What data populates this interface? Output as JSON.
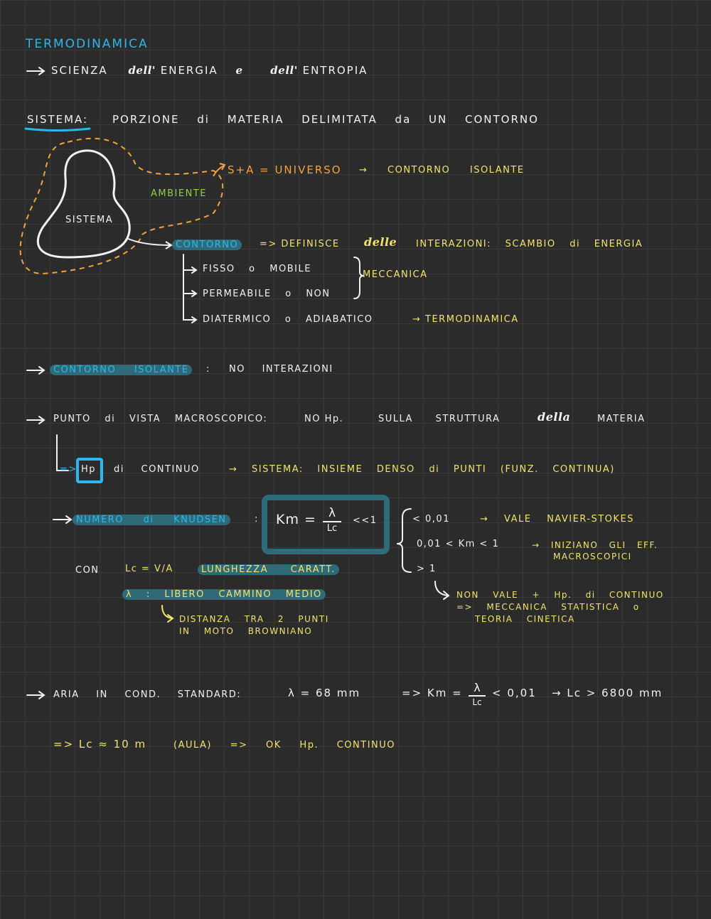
{
  "title": "TERMODINAMICA",
  "intro": {
    "arrow": "→",
    "text1": "SCIENZA",
    "text2": "dell'",
    "text3": "ENERGIA",
    "text4": "e",
    "text5": "dell'",
    "text6": "ENTROPIA"
  },
  "sistema": {
    "label": "SISTEMA",
    "colon": ":",
    "def": "PORZIONE di MATERIA DELIMITATA da UN CONTORNO"
  },
  "diagram": {
    "sistema_label": "SISTEMA",
    "ambiente_label": "AMBIENTE",
    "universo": "S+A = UNIVERSO",
    "universo_note": "→ CONTORNO ISOLANTE",
    "contorno_label": "CONTORNO",
    "contorno_def": "=> DEFINISCE",
    "delle": "delle",
    "interazioni": "INTERAZIONI: SCAMBIO di ENERGIA",
    "fisso": "FISSO o MOBILE",
    "permeabile": "PERMEABILE o NON",
    "meccanica": "MECCANICA",
    "diatermico": "DIATERMICO o ADIABATICO",
    "termo_note": "→ TERMODINAMICA"
  },
  "isolante": {
    "label": "CONTORNO ISOLANTE",
    "colon": ":",
    "text": "NO INTERAZIONI"
  },
  "macro": {
    "text1": "PUNTO di VISTA MACROSCOPICO:",
    "text2": "NO Hp.",
    "text3": "SULLA STRUTTURA",
    "della": "della",
    "text4": "MATERIA",
    "hp_prefix": "=>",
    "hp_box": "Hp",
    "hp_rest": "di CONTINUO",
    "sistema_def": "→ SISTEMA: INSIEME DENSO di PUNTI (FUNZ. CONTINUA)"
  },
  "knudsen": {
    "label": "NUMERO di KNUDSEN",
    "colon": ":",
    "formula_lhs": "Km =",
    "formula_num": "λ",
    "formula_den": "Lc",
    "formula_rhs": "<<1",
    "case1": "< 0,01",
    "case1_note": "→ VALE NAVIER-STOKES",
    "case2": "0,01 < Km < 1",
    "case2_note1": "→ INIZIANO GLI EFF.",
    "case2_note2": "MACROSCOPICI",
    "case3": "> 1",
    "case3_note1": "NON VALE + Hp. di CONTINUO",
    "case3_note2": "=> MECCANICA STATISTICA o",
    "case3_note3": "TEORIA CINETICA",
    "con": "CON",
    "lc_def": "Lc = V/A",
    "lc_text": "LUNGHEZZA CARATT.",
    "lambda_def": "λ : LIBERO CAMMINO MEDIO",
    "lambda_note1": "DISTANZA TRA 2 PUNTI",
    "lambda_note2": "IN MOTO BROWNIANO"
  },
  "aria": {
    "text": "ARIA IN COND. STANDARD:",
    "lambda": "λ = 68 mm",
    "km_prefix": "=> Km =",
    "km_num": "λ",
    "km_den": "Lc",
    "km_rhs": "< 0,01",
    "lc_result": "→ Lc > 6800 mm"
  },
  "conclusion": {
    "lc": "=> Lc ≈ 10 m",
    "rest": "(AULA) => OK Hp. CONTINUO"
  },
  "colors": {
    "blue": "#2bb8ee",
    "yellow": "#f3e36b",
    "green": "#8fcf45",
    "orange": "#f4a33a",
    "highlight": "#2f6a78"
  }
}
